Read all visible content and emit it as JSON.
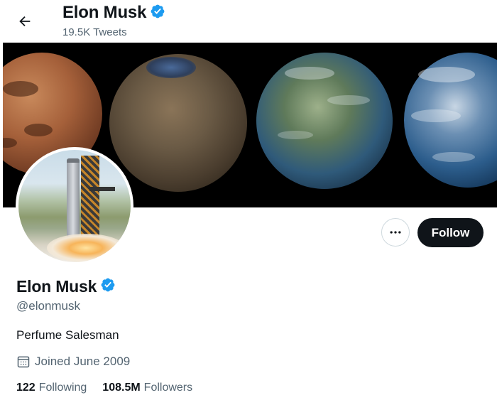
{
  "header": {
    "name": "Elon Musk",
    "tweets_count": "19.5K Tweets"
  },
  "profile": {
    "name": "Elon Musk",
    "handle": "@elonmusk",
    "bio": "Perfume Salesman",
    "joined": "Joined June 2009",
    "verified": true
  },
  "actions": {
    "follow_label": "Follow",
    "more_label": "•••"
  },
  "stats": {
    "following_count": "122",
    "following_label": "Following",
    "followers_count": "108.5M",
    "followers_label": "Followers"
  },
  "colors": {
    "verified": "#1d9bf0",
    "follow_bg": "#0f1419",
    "secondary_text": "#536471"
  }
}
